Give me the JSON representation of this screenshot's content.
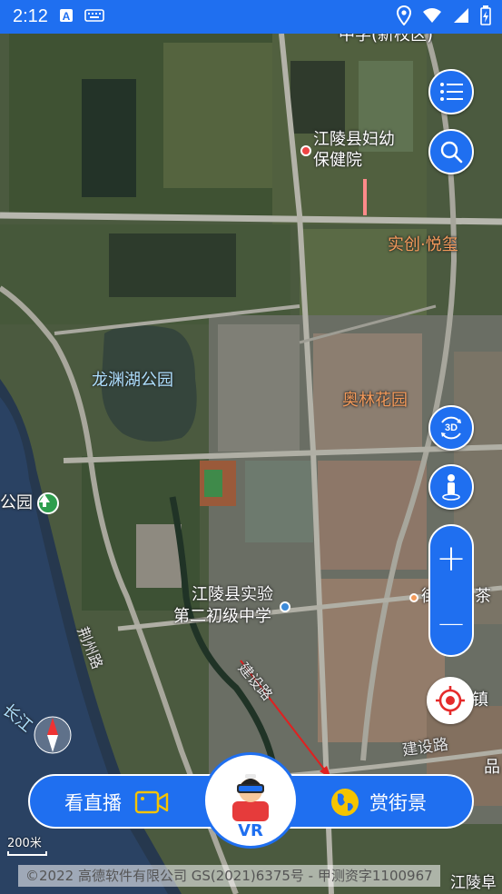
{
  "status_bar": {
    "time": "2:12"
  },
  "map": {
    "labels": {
      "top_cut": "中学(新校区)",
      "hospital": "江陵县妇幼\n保健院",
      "hospital_l1": "江陵县妇幼",
      "hospital_l2": "保健院",
      "shichuang": "实创·悦玺",
      "longyuan": "龙渊湖公园",
      "aolin": "奥林花园",
      "park_cut": "公园",
      "school_l1": "江陵县实验",
      "school_l2": "第二初级中学",
      "jingzhou_rd": "荆州路",
      "road_diag": "建设路",
      "jianshe": "建设路",
      "changjiang": "长江",
      "right_cut1": "街",
      "right_cut2": "茶",
      "right_cut3": "镇",
      "right_cut4": "品",
      "bottom_right": "江陵阜"
    },
    "scale": "200米",
    "copyright": "©2022 高德软件有限公司 GS(2021)6375号 - 甲测资字1100967"
  },
  "controls": {
    "list_icon": "list-icon",
    "search_icon": "search-icon",
    "rotate3d_label": "3D",
    "zoom_in": "+",
    "zoom_out": "—"
  },
  "bottom_bar": {
    "live_label": "看直播",
    "vr_label": "VR",
    "street_label": "赏街景"
  },
  "colors": {
    "accent": "#1f6ff0",
    "orange_label": "#f39a5a"
  }
}
